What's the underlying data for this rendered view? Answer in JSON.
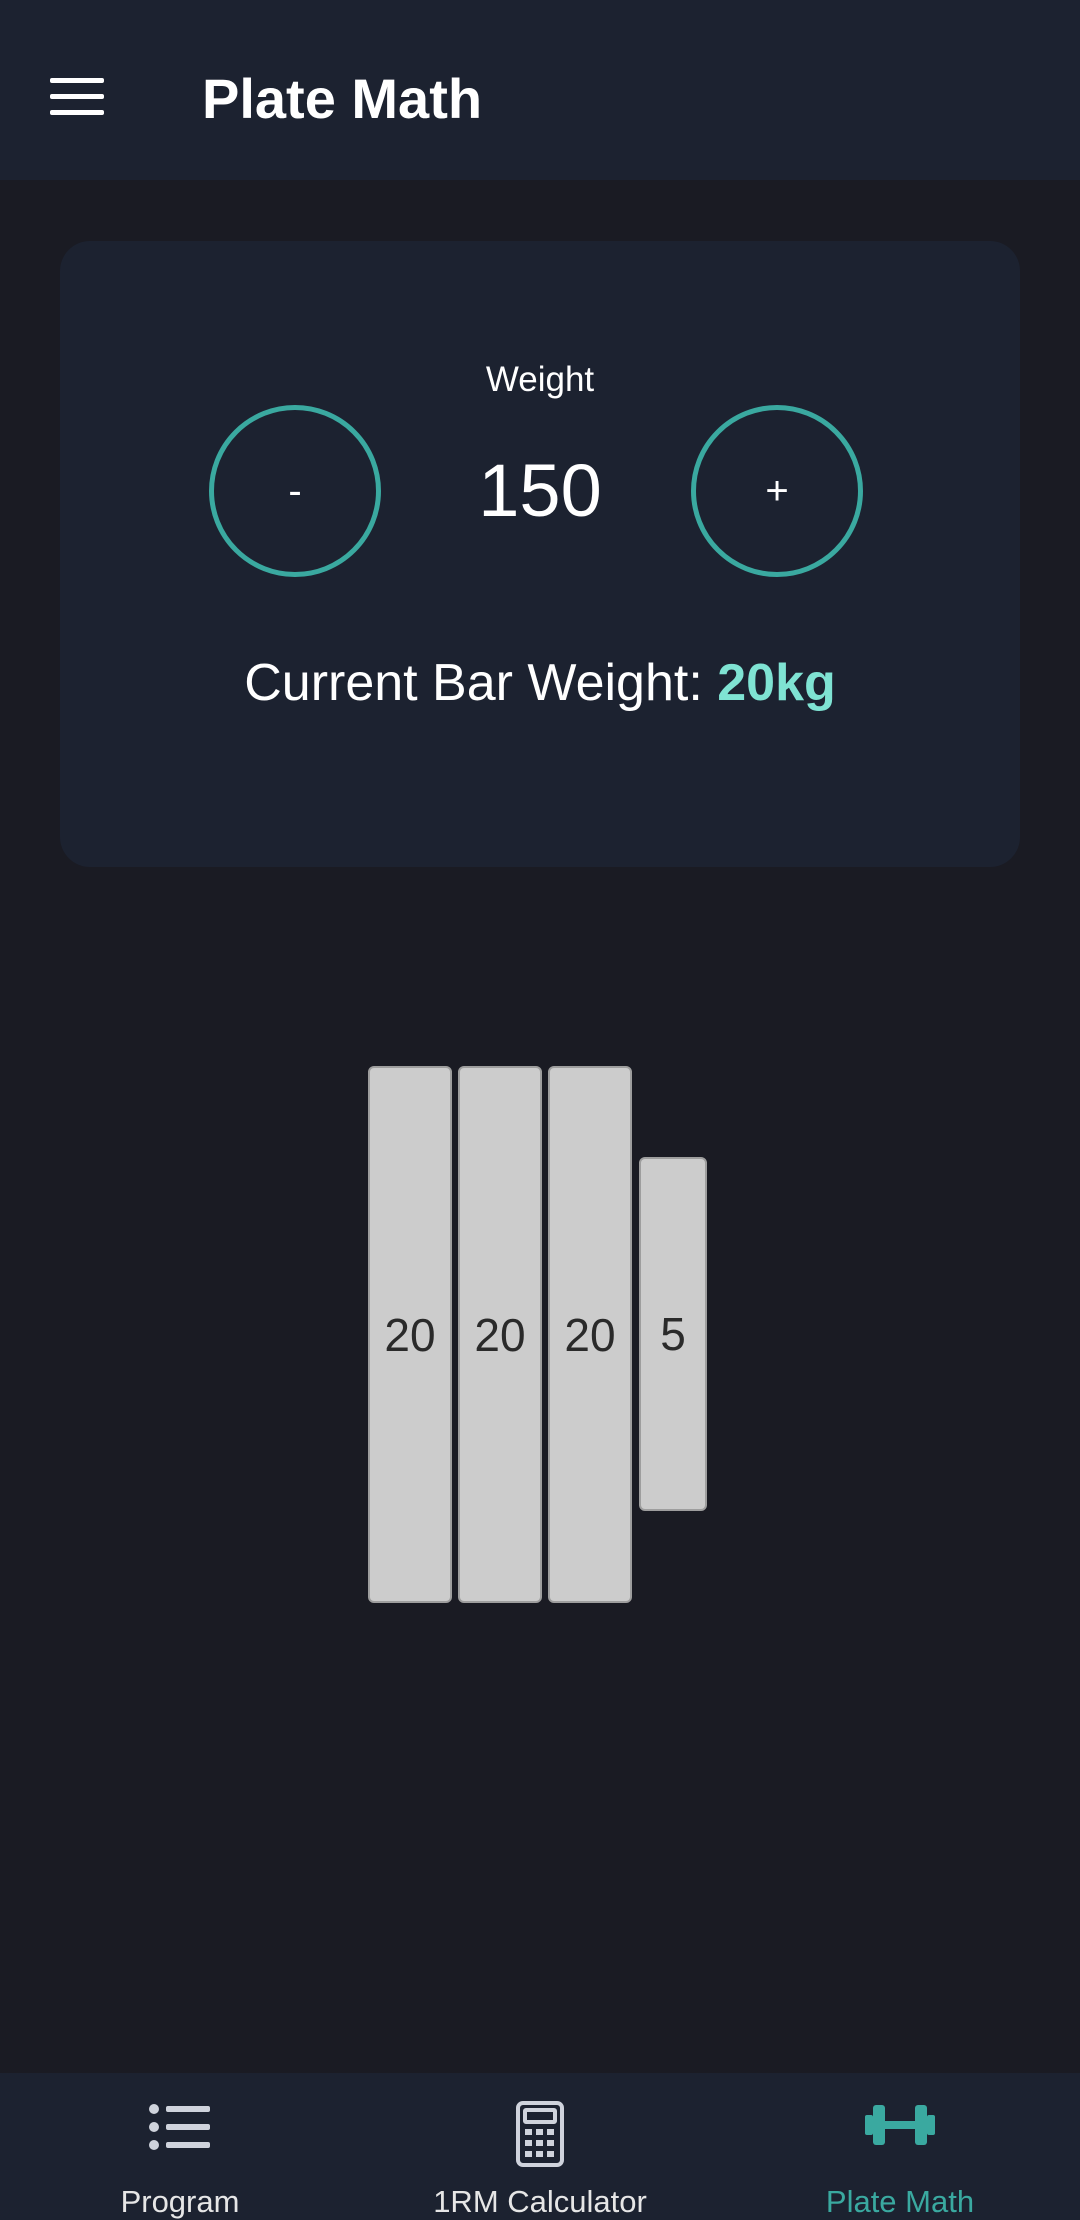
{
  "header": {
    "title": "Plate Math",
    "menu_icon": "hamburger-menu-icon"
  },
  "card": {
    "weight_label": "Weight",
    "weight_value": "150",
    "minus_label": "-",
    "plus_label": "+",
    "bar_weight_prefix": "Current Bar Weight: ",
    "bar_weight_value": "20kg"
  },
  "plates": [
    {
      "label": "20"
    },
    {
      "label": "20"
    },
    {
      "label": "20"
    },
    {
      "label": "5"
    }
  ],
  "bottom_nav": {
    "items": [
      {
        "label": "Program",
        "icon": "list-icon",
        "active": false
      },
      {
        "label": "1RM Calculator",
        "icon": "calculator-icon",
        "active": false
      },
      {
        "label": "Plate Math",
        "icon": "dumbbell-icon",
        "active": true
      }
    ]
  },
  "colors": {
    "accent": "#3aa9a0",
    "accent_light": "#7fe3d3",
    "background": "#1a1b23",
    "surface": "#1c2230",
    "plate": "#cccccc"
  }
}
